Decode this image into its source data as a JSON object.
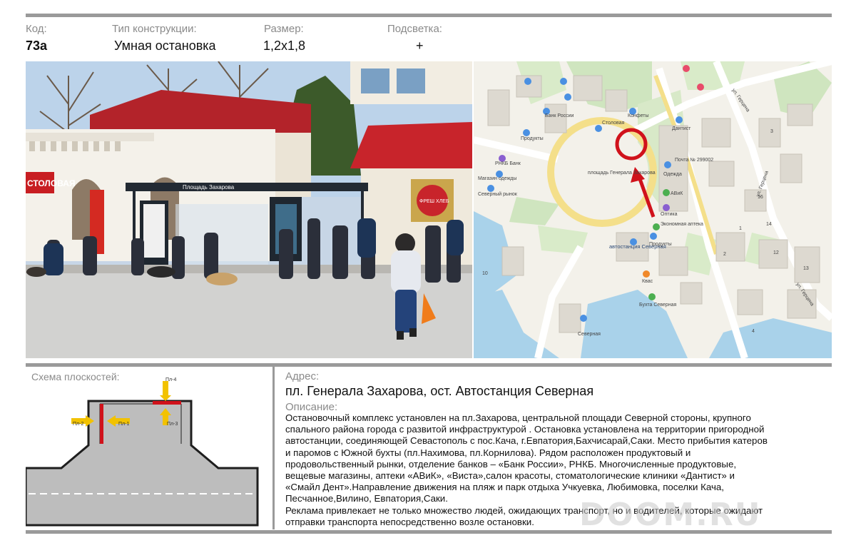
{
  "header": {
    "code_label": "Код:",
    "code_value": "73а",
    "type_label": "Тип конструкции:",
    "type_value": "Умная остановка",
    "size_label": "Размер:",
    "size_value": "1,2х1,8",
    "light_label": "Подсветка:",
    "light_value": "+"
  },
  "photo": {
    "stop_sign": "Площадь Захарова",
    "store_sign": "СТОЛОВАЯ",
    "kiosk_sign": "ФРЕШ ХЛЕБ"
  },
  "map": {
    "labels": {
      "square": "площадь Генерала Захарова",
      "bus_station": "автостанция Северная",
      "pier": "Северная",
      "street_gertsena_1": "ул. Герцена",
      "street_gertsena_2": "ул. Герцена",
      "street_gertsena_3": "ул. Герцена",
      "pochta": "Почта № 299002",
      "odezhda": "Одежда",
      "avik": "АВиК",
      "ochki": "Оптика",
      "apteka": "Экономная аптека",
      "produkty_1": "Продукты",
      "produkty_2": "Продукты",
      "stolovaya": "Столовая",
      "konfeti": "Конфеты",
      "rnkb": "РНКБ Банк",
      "bank_rossii": "Банк России",
      "magazin_odezhdy": "Магазин одежды",
      "severny_rynok": "Северный рынок",
      "dantist": "Дантист",
      "bukhta": "Бухта Северная",
      "kvas": "Квас",
      "na_10": "10",
      "house_2": "2",
      "house_3": "3",
      "house_14": "14",
      "house_16": "16",
      "house_12": "12",
      "house_1": "1",
      "house_13": "13",
      "house_4": "4"
    }
  },
  "scheme": {
    "title": "Схема плоскостей:",
    "planes": [
      "Пл-1",
      "Пл-2",
      "Пл-3",
      "Пл-4"
    ]
  },
  "address": {
    "label": "Адрес:",
    "value": "пл. Генерала Захарова, ост. Автостанция Северная"
  },
  "description": {
    "label": "Описание:",
    "lines": [
      "Остановочный комплекс установлен на пл.Захарова, центральной площади Северной стороны,  крупного",
      "спального района города  с развитой инфраструктурой   . Остановка установлена на территории  пригородной",
      "автостанции, соединяющей  Севастополь с пос.Кача, г.Евпатория,Бахчисарай,Саки. Место прибытия катеров",
      "и паромов с Южной бухты (пл.Нахимова, пл.Корнилова). Рядом  расположен  продуктовый и",
      "продовольственный рынки, отделение банков – «Банк России», РНКБ. Многочисленные продуктовые,",
      "вещевые магазины, аптеки «АВиК», «Виста»,салон красоты, стоматологические клиники  «Дантист» и",
      "«Смайл Дент».Направление движения на пляж и парк отдыха Учкуевка, Любимовка, поселки Кача,",
      "Песчанное,Вилино, Евпатория,Саки.",
      "Реклама привлекает не только множество людей, ожидающих транспорт, но и водителей, которые ожидают",
      "отправки транспорта непосредственно возле остановки."
    ]
  },
  "watermark": "DOOM.RU",
  "colors": {
    "accent_red": "#d0121b",
    "arrow_yellow": "#f2c200",
    "bar_gray": "#9a9a9a",
    "road_gray": "#bdbdbd"
  }
}
